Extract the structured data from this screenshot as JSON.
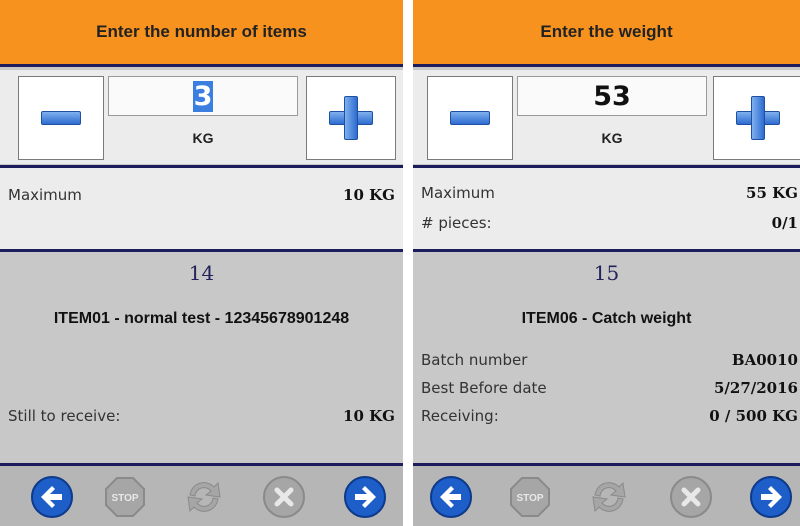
{
  "left": {
    "header": "Enter the number of items",
    "value": "3",
    "unit": "KG",
    "maximum_label": "Maximum",
    "maximum_value": "10 KG",
    "item_number": "14",
    "item_name": "ITEM01 - normal test - 12345678901248",
    "still_label": "Still to receive:",
    "still_value": "10 KG"
  },
  "right": {
    "header": "Enter the weight",
    "value": "53",
    "unit": "KG",
    "maximum_label": "Maximum",
    "maximum_value": "55 KG",
    "pieces_label": "# pieces:",
    "pieces_value": "0/1",
    "item_number": "15",
    "item_name": "ITEM06 - Catch weight",
    "batch_label": "Batch number",
    "batch_value": "BA0010",
    "bbd_label": "Best Before date",
    "bbd_value": "5/27/2016",
    "receiving_label": "Receiving:",
    "receiving_value": "0 / 500 KG"
  },
  "footer_icons": [
    "back-arrow-icon",
    "stop-icon",
    "refresh-icon",
    "cancel-icon",
    "forward-arrow-icon"
  ],
  "footer_stop_text": "STOP",
  "colors": {
    "header": "#f7921e",
    "divider": "#1d1d5e",
    "arrow_blue": "#1e5ec8",
    "disabled_gray": "#a6a6a6"
  }
}
